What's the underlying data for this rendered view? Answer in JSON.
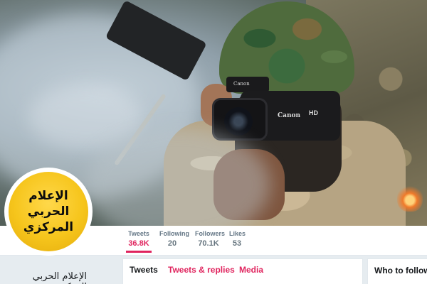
{
  "avatar": {
    "lines": [
      "الإعلام",
      "الحربي",
      "المركزي"
    ]
  },
  "camera": {
    "brand": "Canon",
    "brand_small": "Canon",
    "badge": "HD"
  },
  "stats": {
    "tweets": {
      "label": "Tweets",
      "value": "36.8K"
    },
    "following": {
      "label": "Following",
      "value": "20"
    },
    "followers": {
      "label": "Followers",
      "value": "70.1K"
    },
    "likes": {
      "label": "Likes",
      "value": "53"
    }
  },
  "profile": {
    "name": "الإعلام الحربي المركزي"
  },
  "tabs": {
    "tweets": "Tweets",
    "replies": "Tweets & replies",
    "media": "Media"
  },
  "sidebar": {
    "who_to_follow": "Who to follow ·"
  },
  "colors": {
    "accent": "#e0245e",
    "avatar_yellow": "#f6c51c",
    "background": "#e6ecf0"
  }
}
